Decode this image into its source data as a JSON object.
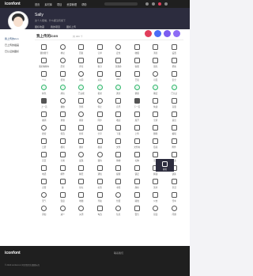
{
  "topbar": {
    "logo": "iconfont",
    "nav": [
      "首页",
      "素材库",
      "项目",
      "资源管理",
      "帮助"
    ],
    "search_placeholder": "搜索图标"
  },
  "banner": {
    "name": "Sally",
    "desc": "这个人很懒，什么都没有留下",
    "tabs": [
      "图标收藏",
      "我的项目",
      "图标上传"
    ]
  },
  "sidebar": {
    "items": [
      {
        "label": "我上传的icon",
        "active": true
      },
      {
        "label": "已上传的插画",
        "active": false
      },
      {
        "label": "已认证的图标",
        "active": false
      }
    ]
  },
  "main": {
    "title": "我上传的icon",
    "subtitle": "共 300 个",
    "action_colors": [
      "#e13d5b",
      "#4a6cf7",
      "#7b5cf0",
      "#8d6cf5"
    ]
  },
  "icons": [
    {
      "label": "我的账号",
      "style": ""
    },
    {
      "label": "地址",
      "style": "round"
    },
    {
      "label": "回复",
      "style": ""
    },
    {
      "label": "订单",
      "style": ""
    },
    {
      "label": "定位",
      "style": "round"
    },
    {
      "label": "收藏",
      "style": ""
    },
    {
      "label": "消息",
      "style": ""
    },
    {
      "label": "设置",
      "style": ""
    },
    {
      "label": "我的购物车",
      "style": ""
    },
    {
      "label": "历史",
      "style": "round"
    },
    {
      "label": "评论",
      "style": ""
    },
    {
      "label": "积分",
      "style": ""
    },
    {
      "label": "优惠券",
      "style": ""
    },
    {
      "label": "客服",
      "style": ""
    },
    {
      "label": "钱包",
      "style": ""
    },
    {
      "label": "帮助",
      "style": ""
    },
    {
      "label": "个人",
      "style": ""
    },
    {
      "label": "签到",
      "style": ""
    },
    {
      "label": "时间",
      "style": "round"
    },
    {
      "label": "关注",
      "style": ""
    },
    {
      "label": "WiFi",
      "style": ""
    },
    {
      "label": "已读",
      "style": ""
    },
    {
      "label": "可见",
      "style": "round"
    },
    {
      "label": "安全",
      "style": ""
    },
    {
      "label": "绿色",
      "style": "green"
    },
    {
      "label": "成功",
      "style": "green"
    },
    {
      "label": "已完成",
      "style": "green"
    },
    {
      "label": "提交",
      "style": "green"
    },
    {
      "label": "通过",
      "style": "green"
    },
    {
      "label": "健康",
      "style": "green"
    },
    {
      "label": "确定",
      "style": "green"
    },
    {
      "label": "已认证",
      "style": "green"
    },
    {
      "label": "上一首",
      "style": "fill"
    },
    {
      "label": "播放",
      "style": "round"
    },
    {
      "label": "暂停",
      "style": ""
    },
    {
      "label": "停止",
      "style": "round"
    },
    {
      "label": "音乐",
      "style": ""
    },
    {
      "label": "下一首",
      "style": "fill"
    },
    {
      "label": "快进",
      "style": ""
    },
    {
      "label": "音量",
      "style": ""
    },
    {
      "label": "撤销",
      "style": ""
    },
    {
      "label": "重做",
      "style": ""
    },
    {
      "label": "刷新",
      "style": "round"
    },
    {
      "label": "同步",
      "style": ""
    },
    {
      "label": "收起",
      "style": ""
    },
    {
      "label": "展开",
      "style": ""
    },
    {
      "label": "全屏",
      "style": ""
    },
    {
      "label": "退出",
      "style": ""
    },
    {
      "label": "搜索",
      "style": "round"
    },
    {
      "label": "筛选",
      "style": ""
    },
    {
      "label": "排序",
      "style": ""
    },
    {
      "label": "分享",
      "style": ""
    },
    {
      "label": "下载",
      "style": ""
    },
    {
      "label": "上传",
      "style": ""
    },
    {
      "label": "删除",
      "style": ""
    },
    {
      "label": "编辑",
      "style": ""
    },
    {
      "label": "日历",
      "style": ""
    },
    {
      "label": "相机",
      "style": ""
    },
    {
      "label": "图片",
      "style": ""
    },
    {
      "label": "视频",
      "style": ""
    },
    {
      "label": "文件",
      "style": ""
    },
    {
      "label": "文件夹",
      "style": ""
    },
    {
      "label": "链接",
      "style": ""
    },
    {
      "label": "附件",
      "style": ""
    },
    {
      "label": "首页",
      "style": ""
    },
    {
      "label": "分类",
      "style": ""
    },
    {
      "label": "发现",
      "style": "round"
    },
    {
      "label": "我的",
      "style": "round"
    },
    {
      "label": "购物",
      "style": ""
    },
    {
      "label": "礼物",
      "style": ""
    },
    {
      "label": "活动",
      "style": ""
    },
    {
      "label": "更多",
      "style": ""
    },
    {
      "label": "电话",
      "style": ""
    },
    {
      "label": "邮件",
      "style": ""
    },
    {
      "label": "聊天",
      "style": ""
    },
    {
      "label": "通知",
      "style": ""
    },
    {
      "label": "提醒",
      "style": ""
    },
    {
      "label": "锁定",
      "style": ""
    },
    {
      "label": "解锁",
      "style": ""
    },
    {
      "label": "钥匙",
      "style": ""
    },
    {
      "label": "点赞",
      "style": ""
    },
    {
      "label": "踩",
      "style": ""
    },
    {
      "label": "星标",
      "style": ""
    },
    {
      "label": "标签",
      "style": ""
    },
    {
      "label": "书签",
      "style": ""
    },
    {
      "label": "旗帜",
      "style": ""
    },
    {
      "label": "奖杯",
      "style": ""
    },
    {
      "label": "皇冠",
      "style": ""
    },
    {
      "label": "天气",
      "style": "round"
    },
    {
      "label": "温度",
      "style": ""
    },
    {
      "label": "地图",
      "style": ""
    },
    {
      "label": "导航",
      "style": ""
    },
    {
      "label": "位置",
      "style": "round"
    },
    {
      "label": "路线",
      "style": ""
    },
    {
      "label": "公交",
      "style": ""
    },
    {
      "label": "驾车",
      "style": ""
    },
    {
      "label": "添加",
      "style": "round"
    },
    {
      "label": "减少",
      "style": "round"
    },
    {
      "label": "关闭",
      "style": "round"
    },
    {
      "label": "勾选",
      "style": ""
    },
    {
      "label": "信息",
      "style": "round"
    },
    {
      "label": "警告",
      "style": ""
    },
    {
      "label": "错误",
      "style": "round"
    },
    {
      "label": "问题",
      "style": "round"
    }
  ],
  "hover": {
    "label": "编辑"
  },
  "footer": {
    "logo": "iconfont",
    "link": "联系我们",
    "copy": "© 2024 iconfont.cn 阿里巴巴矢量图标库"
  }
}
